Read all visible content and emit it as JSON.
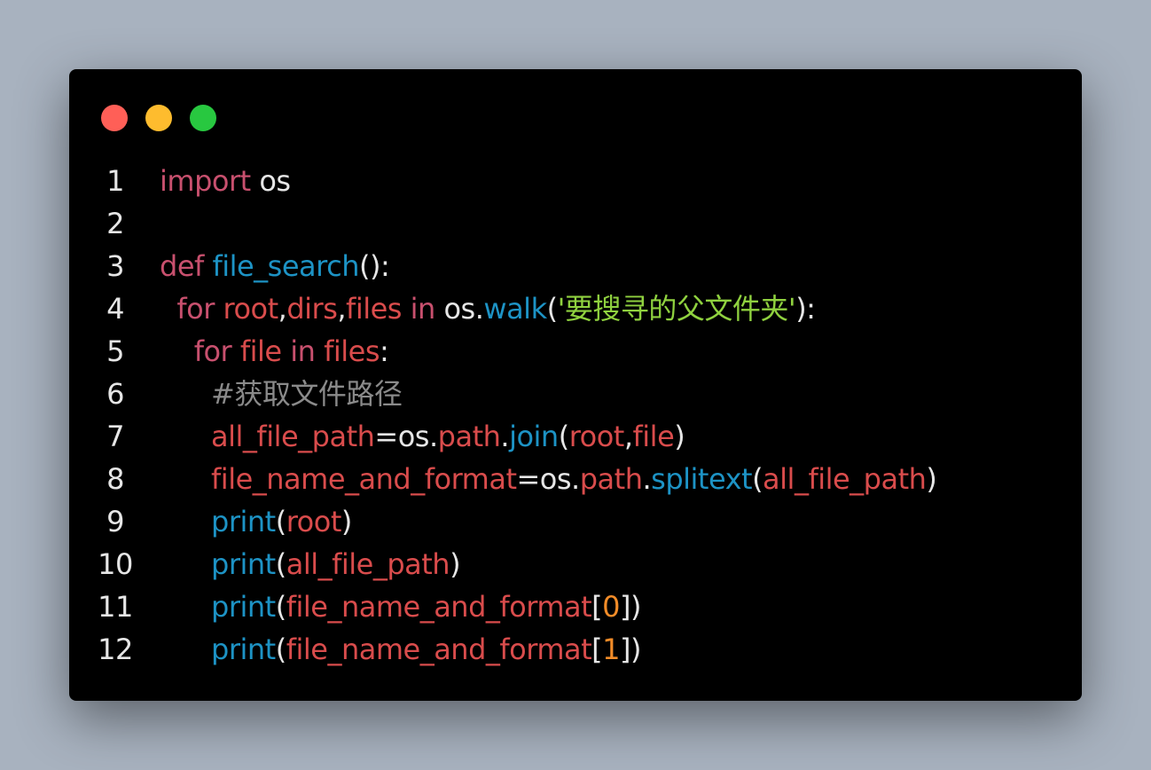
{
  "colors": {
    "background": "#a8b2bf",
    "window": "#000000",
    "keyword": "#c8506e",
    "variable": "#d94c4c",
    "function": "#1d93c5",
    "string": "#8fd13f",
    "comment": "#8a8a8a",
    "number": "#f28c28",
    "plain": "#e6e6e6",
    "traffic_red": "#ff5f57",
    "traffic_yellow": "#febc2e",
    "traffic_green": "#28c840"
  },
  "window_controls": [
    {
      "name": "close",
      "color": "#ff5f57"
    },
    {
      "name": "minimize",
      "color": "#febc2e"
    },
    {
      "name": "maximize",
      "color": "#28c840"
    }
  ],
  "code_lines": [
    {
      "number": "1",
      "tokens": [
        {
          "t": "import",
          "c": "keyword"
        },
        {
          "t": " os",
          "c": "plain"
        }
      ]
    },
    {
      "number": "2",
      "tokens": []
    },
    {
      "number": "3",
      "tokens": [
        {
          "t": "def",
          "c": "keyword"
        },
        {
          "t": " ",
          "c": "plain"
        },
        {
          "t": "file_search",
          "c": "function"
        },
        {
          "t": "():",
          "c": "plain"
        }
      ]
    },
    {
      "number": "4",
      "tokens": [
        {
          "t": "  for",
          "c": "keyword"
        },
        {
          "t": " root",
          "c": "variable"
        },
        {
          "t": ",",
          "c": "plain"
        },
        {
          "t": "dirs",
          "c": "variable"
        },
        {
          "t": ",",
          "c": "plain"
        },
        {
          "t": "files",
          "c": "variable"
        },
        {
          "t": " in",
          "c": "keyword"
        },
        {
          "t": " os.",
          "c": "plain"
        },
        {
          "t": "walk",
          "c": "function"
        },
        {
          "t": "(",
          "c": "plain"
        },
        {
          "t": "'要搜寻的父文件夹'",
          "c": "string"
        },
        {
          "t": "):",
          "c": "plain"
        }
      ]
    },
    {
      "number": "5",
      "tokens": [
        {
          "t": "    for",
          "c": "keyword"
        },
        {
          "t": " file",
          "c": "variable"
        },
        {
          "t": " in",
          "c": "keyword"
        },
        {
          "t": " files",
          "c": "variable"
        },
        {
          "t": ":",
          "c": "plain"
        }
      ]
    },
    {
      "number": "6",
      "tokens": [
        {
          "t": "      #获取文件路径",
          "c": "comment"
        }
      ]
    },
    {
      "number": "7",
      "tokens": [
        {
          "t": "      all_file_path",
          "c": "variable"
        },
        {
          "t": "=os.",
          "c": "plain"
        },
        {
          "t": "path",
          "c": "variable"
        },
        {
          "t": ".",
          "c": "plain"
        },
        {
          "t": "join",
          "c": "function"
        },
        {
          "t": "(",
          "c": "plain"
        },
        {
          "t": "root",
          "c": "variable"
        },
        {
          "t": ",",
          "c": "plain"
        },
        {
          "t": "file",
          "c": "variable"
        },
        {
          "t": ")",
          "c": "plain"
        }
      ]
    },
    {
      "number": "8",
      "tokens": [
        {
          "t": "      file_name_and_format",
          "c": "variable"
        },
        {
          "t": "=os.",
          "c": "plain"
        },
        {
          "t": "path",
          "c": "variable"
        },
        {
          "t": ".",
          "c": "plain"
        },
        {
          "t": "splitext",
          "c": "function"
        },
        {
          "t": "(",
          "c": "plain"
        },
        {
          "t": "all_file_path",
          "c": "variable"
        },
        {
          "t": ")",
          "c": "plain"
        }
      ]
    },
    {
      "number": "9",
      "tokens": [
        {
          "t": "      print",
          "c": "function"
        },
        {
          "t": "(",
          "c": "plain"
        },
        {
          "t": "root",
          "c": "variable"
        },
        {
          "t": ")",
          "c": "plain"
        }
      ]
    },
    {
      "number": "10",
      "tokens": [
        {
          "t": "      print",
          "c": "function"
        },
        {
          "t": "(",
          "c": "plain"
        },
        {
          "t": "all_file_path",
          "c": "variable"
        },
        {
          "t": ")",
          "c": "plain"
        }
      ]
    },
    {
      "number": "11",
      "tokens": [
        {
          "t": "      print",
          "c": "function"
        },
        {
          "t": "(",
          "c": "plain"
        },
        {
          "t": "file_name_and_format",
          "c": "variable"
        },
        {
          "t": "[",
          "c": "plain"
        },
        {
          "t": "0",
          "c": "number"
        },
        {
          "t": "])",
          "c": "plain"
        }
      ]
    },
    {
      "number": "12",
      "tokens": [
        {
          "t": "      print",
          "c": "function"
        },
        {
          "t": "(",
          "c": "plain"
        },
        {
          "t": "file_name_and_format",
          "c": "variable"
        },
        {
          "t": "[",
          "c": "plain"
        },
        {
          "t": "1",
          "c": "number"
        },
        {
          "t": "])",
          "c": "plain"
        }
      ]
    }
  ]
}
